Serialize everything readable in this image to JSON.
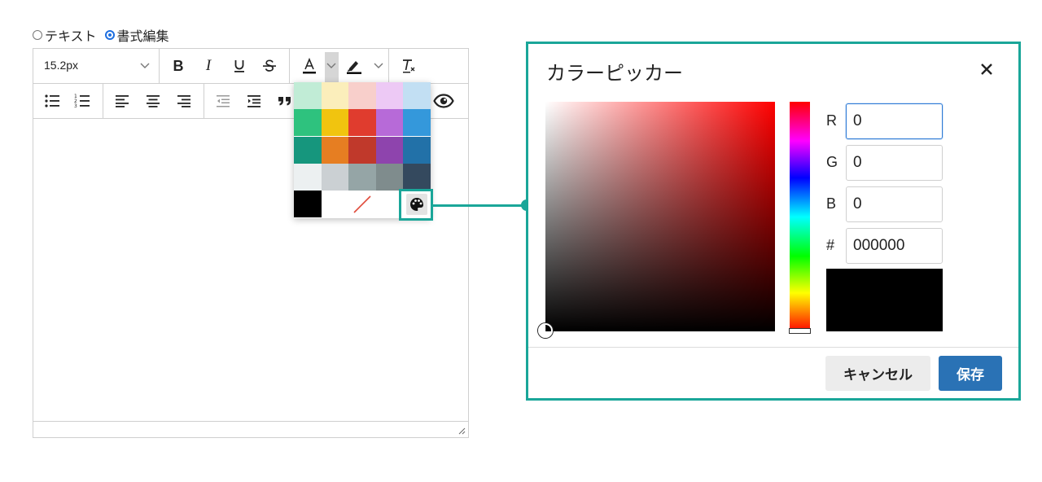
{
  "mode": {
    "text_label": "テキスト",
    "format_label": "書式編集",
    "selected": "format"
  },
  "toolbar": {
    "font_size": "15.2px",
    "bold": "B",
    "italic": "I",
    "text_color_letter": "A"
  },
  "swatches": {
    "colors": [
      [
        "#c1ecd6",
        "#fbeebb",
        "#f8cfcb",
        "#edc9f5",
        "#c2dff3"
      ],
      [
        "#2ec27e",
        "#f1c40f",
        "#e03c2e",
        "#b76ad8",
        "#3498db"
      ],
      [
        "#16967d",
        "#e67e22",
        "#c0392b",
        "#8e44ad",
        "#2271a8"
      ],
      [
        "#ecf0f1",
        "#cbd0d3",
        "#95a5a6",
        "#7f8c8d",
        "#34495e"
      ]
    ],
    "black": "#000000",
    "none_slash_color": "#e04a3a"
  },
  "dialog": {
    "title": "カラーピッカー",
    "channels": [
      {
        "label": "R",
        "value": "0"
      },
      {
        "label": "G",
        "value": "0"
      },
      {
        "label": "B",
        "value": "0"
      }
    ],
    "hex_label": "#",
    "hex_value": "000000",
    "preview_color": "#000000",
    "cancel_label": "キャンセル",
    "save_label": "保存"
  },
  "accent_color": "#1aa699"
}
